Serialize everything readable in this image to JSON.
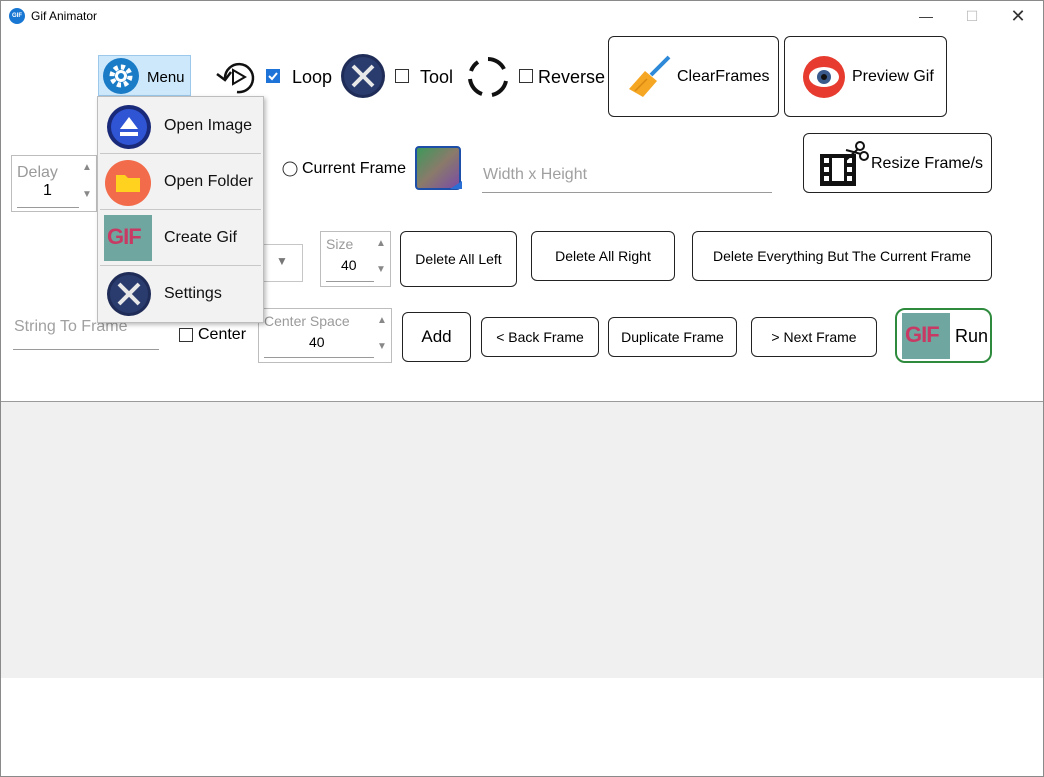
{
  "window": {
    "title": "Gif Animator",
    "icon_text": "GIF",
    "minimize": "—",
    "maximize": "☐",
    "close": "✕"
  },
  "toolbar": {
    "menu_label": "Menu",
    "loop_label": "Loop",
    "loop_checked": true,
    "tool_label": "Tool",
    "tool_checked": false,
    "reverse_label": "Reverse",
    "reverse_checked": false,
    "clear_frames_label": "ClearFrames",
    "preview_gif_label": "Preview Gif"
  },
  "menu": {
    "items": [
      {
        "label": "Open Image",
        "icon": "eject-icon"
      },
      {
        "label": "Open Folder",
        "icon": "folder-icon"
      },
      {
        "label": "Create Gif",
        "icon": "gif-icon"
      },
      {
        "label": "Settings",
        "icon": "tools-icon"
      }
    ]
  },
  "gif_badge_text": "GIF",
  "row2": {
    "delay_caption": "Delay",
    "delay_value": "1",
    "current_frame_label": "Current Frame",
    "size_placeholder": "Width x Height",
    "resize_label": "Resize Frame/s"
  },
  "row3": {
    "size_caption": "Size",
    "size_value": "40",
    "delete_left": "Delete All Left",
    "delete_right": "Delete All Right",
    "delete_all_but": "Delete Everything But The Current Frame"
  },
  "row4": {
    "string_placeholder": "String To Frame",
    "center_label": "Center",
    "center_checked": false,
    "center_space_caption": "Center Space",
    "center_space_value": "40",
    "add_label": "Add",
    "back_frame": "< Back Frame",
    "duplicate_frame": "Duplicate Frame",
    "next_frame": "> Next Frame",
    "run_label": "Run"
  },
  "colors": {
    "menu_highlight": "#cde8fb",
    "accent_blue": "#1e73d9",
    "run_border": "#2e8b3e",
    "canvas_bg": "#f0f0f0"
  }
}
